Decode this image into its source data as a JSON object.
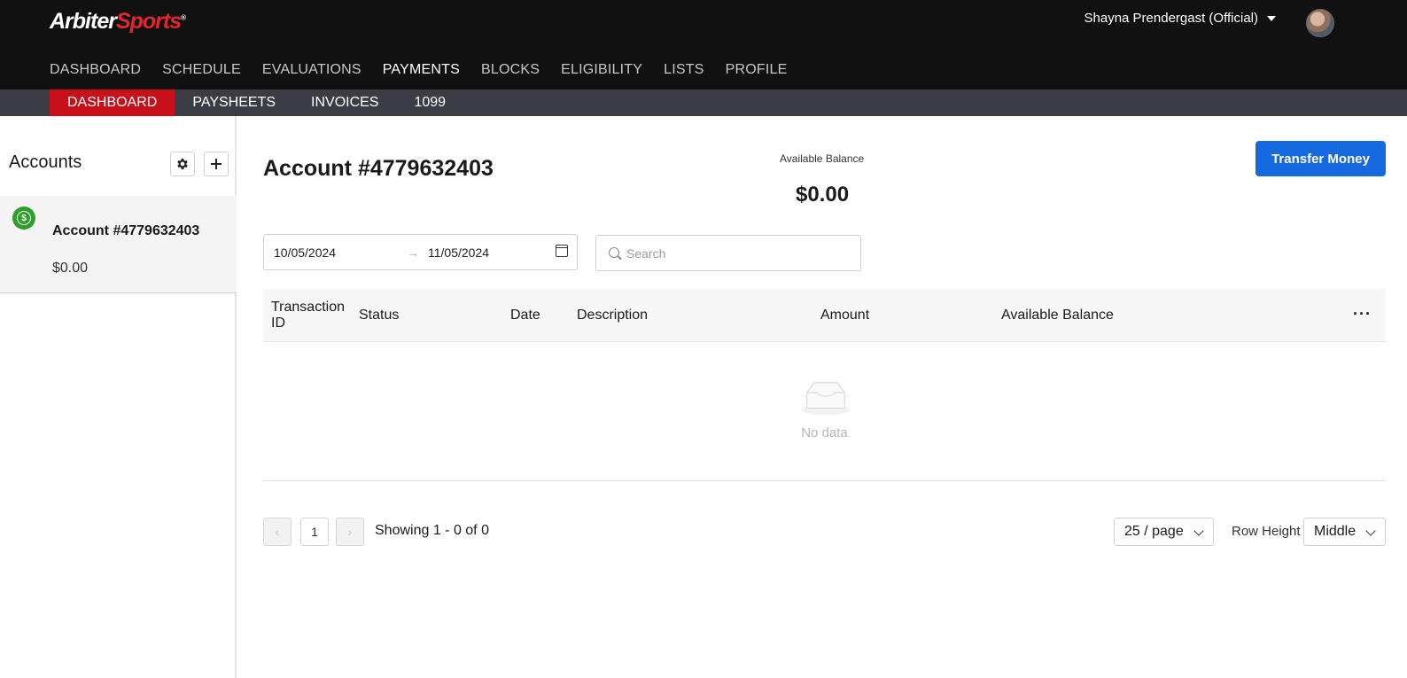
{
  "header": {
    "logo_part1": "Arbiter",
    "logo_part2": "Sports",
    "logo_mark": "®",
    "user_name": "Shayna Prendergast (Official)",
    "avatar_icon": "user-avatar-photo"
  },
  "main_nav": [
    {
      "label": "DASHBOARD",
      "active": false
    },
    {
      "label": "SCHEDULE",
      "active": false
    },
    {
      "label": "EVALUATIONS",
      "active": false
    },
    {
      "label": "PAYMENTS",
      "active": true
    },
    {
      "label": "BLOCKS",
      "active": false
    },
    {
      "label": "ELIGIBILITY",
      "active": false
    },
    {
      "label": "LISTS",
      "active": false
    },
    {
      "label": "PROFILE",
      "active": false
    }
  ],
  "sub_nav": [
    {
      "label": "DASHBOARD",
      "active": true
    },
    {
      "label": "PAYSHEETS",
      "active": false
    },
    {
      "label": "INVOICES",
      "active": false
    },
    {
      "label": "1099",
      "active": false
    }
  ],
  "sidebar": {
    "title": "Accounts",
    "settings_icon": "gear-icon",
    "add_icon": "plus-icon",
    "accounts": [
      {
        "name": "Account #4779632403",
        "balance": "$0.00",
        "icon": "dollar-circle-icon"
      }
    ]
  },
  "main": {
    "account_title": "Account #4779632403",
    "available_balance_label": "Available Balance",
    "available_balance_value": "$0.00",
    "transfer_button": "Transfer Money",
    "date_from": "10/05/2024",
    "date_to": "11/05/2024",
    "date_arrow": "→",
    "search_placeholder": "Search",
    "table": {
      "columns": [
        "Transaction ID",
        "Status",
        "Date",
        "Description",
        "Amount",
        "Available Balance"
      ],
      "more_icon": "ellipsis-icon",
      "empty_text": "No data"
    },
    "pagination": {
      "prev": "‹",
      "current_page": "1",
      "next": "›",
      "showing": "Showing 1 - 0 of 0",
      "page_size": "25 / page",
      "row_height_label": "Row Height",
      "row_height_value": "Middle"
    }
  },
  "colors": {
    "header_bg": "#111111",
    "subnav_bg": "#3b3c44",
    "subnav_active": "#c8101a",
    "primary_button": "#1769e0",
    "account_icon": "#2f9e2b"
  }
}
